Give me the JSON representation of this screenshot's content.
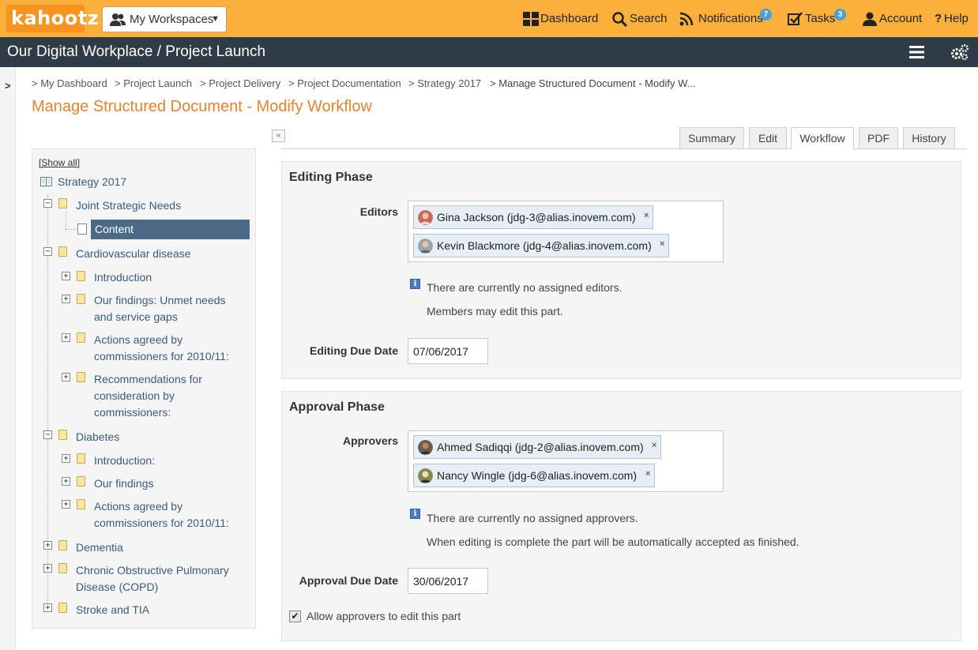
{
  "app": {
    "logo_text": "kahootz",
    "workspace_button": "My Workspaces",
    "nav": {
      "dashboard": "Dashboard",
      "search": "Search",
      "notifications": "Notifications",
      "notifications_count": "7",
      "tasks": "Tasks",
      "tasks_count": "3",
      "account": "Account",
      "help": "Help"
    },
    "brand_color": "#fbb03b",
    "title_bar_color": "#2f3b46"
  },
  "title_bar": {
    "title": "Our Digital Workplace / Project Launch"
  },
  "rail": {
    "toggle": ">"
  },
  "breadcrumb": [
    "> My Dashboard",
    "> Project Launch",
    "> Project Delivery",
    "> Project Documentation",
    "> Strategy 2017",
    "> Manage Structured Document - Modify W..."
  ],
  "page_title": "Manage Structured Document - Modify Workflow",
  "collapse_label": "«",
  "tree": {
    "show_all": "[Show all]",
    "root": "Strategy 2017",
    "nodes": [
      "Joint Strategic Needs",
      "Content",
      "Cardiovascular disease",
      "Introduction",
      "Our findings: Unmet needs",
      "and service gaps",
      "Actions agreed by",
      "commissioners for 2010/11:",
      "Recommendations for",
      "consideration by",
      "commissioners:",
      "Diabetes",
      "Introduction:",
      "Our findings",
      "Actions agreed by",
      "commissioners for 2010/11:",
      "Dementia",
      "Chronic Obstructive Pulmonary",
      "Disease (COPD)",
      "Stroke and TIA"
    ]
  },
  "tabs": [
    "Summary",
    "Edit",
    "Workflow",
    "PDF",
    "History"
  ],
  "active_tab": "Workflow",
  "editing": {
    "title": "Editing Phase",
    "editors_label": "Editors",
    "editors": [
      "Gina Jackson (jdg-3@alias.inovem.com)",
      "Kevin Blackmore (jdg-4@alias.inovem.com)"
    ],
    "info_line1": "There are currently no assigned editors.",
    "info_line2": "Members may edit this part.",
    "due_label": "Editing Due Date",
    "due_value": "07/06/2017"
  },
  "approval": {
    "title": "Approval Phase",
    "approvers_label": "Approvers",
    "approvers": [
      "Ahmed Sadiqqi (jdg-2@alias.inovem.com)",
      "Nancy Wingle (jdg-6@alias.inovem.com)"
    ],
    "info_line1": "There are currently no assigned approvers.",
    "info_line2": "When editing is complete the part will be automatically accepted as finished.",
    "due_label": "Approval Due Date",
    "due_value": "30/06/2017",
    "allow_edit_label": "Allow approvers to edit this part",
    "allow_edit_checked": true
  },
  "remove_glyph": "×",
  "info_glyph": "i",
  "check_glyph": "✔"
}
